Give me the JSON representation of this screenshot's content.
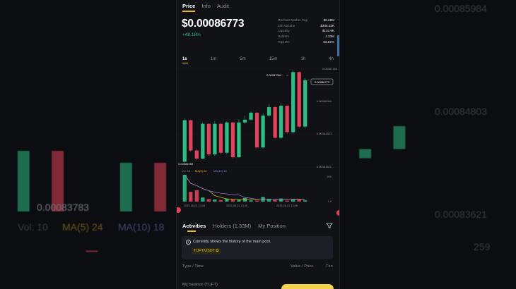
{
  "background": {
    "price_labels": [
      "0.00085984",
      "0.00084803",
      "0.00083621"
    ],
    "low_label": "0.00083783",
    "volume_label": "Vol: 10",
    "ma5_label": "MA(5) 24",
    "ma10_label": "MA(10) 18",
    "volume_max": "259"
  },
  "tabs": [
    {
      "label": "Price",
      "active": true
    },
    {
      "label": "Info",
      "active": false
    },
    {
      "label": "Audit",
      "active": false
    }
  ],
  "price": {
    "value": "$0.00086773",
    "change": "+48.18%"
  },
  "stats": [
    {
      "label": "Onchain Market Cap",
      "value": "$8.68M"
    },
    {
      "label": "24h Volume",
      "value": "$306.02K"
    },
    {
      "label": "Liquidity",
      "value": "$132.9K"
    },
    {
      "label": "Holders",
      "value": "1.33M"
    },
    {
      "label": "Top10%",
      "value": "53.92%"
    }
  ],
  "intervals": [
    {
      "label": "1s",
      "active": true
    },
    {
      "label": "1m",
      "active": false
    },
    {
      "label": "5m",
      "active": false
    },
    {
      "label": "15m",
      "active": false
    },
    {
      "label": "1h",
      "active": false
    },
    {
      "label": "4h",
      "active": false
    }
  ],
  "chart": {
    "high_label": "0.00087064",
    "low_label": "0.00083783",
    "current_label": "0.00086773",
    "price_ticks": [
      "0.00087166",
      "0.00085984",
      "0.00084803",
      "0.00083621"
    ],
    "volume_legend": {
      "vol": "Vol: 10",
      "ma5": "MA(5) 24",
      "ma10": "MA(10) 18"
    },
    "volume_ticks": [
      "259",
      "1.6"
    ],
    "time_labels": [
      "2025-06-01 13:44",
      "2025-06-01 13:45",
      "2025-06-01 13:46"
    ],
    "colors": {
      "up": "#2ebd85",
      "down": "#e0425a",
      "ma5": "#f0b90b",
      "ma10": "#8f7ae6"
    }
  },
  "chart_data": {
    "type": "candlestick",
    "candles": [
      {
        "o": 0.0008384,
        "c": 0.0008533,
        "h": 0.000854,
        "l": 0.0008378,
        "dir": "up"
      },
      {
        "o": 0.0008533,
        "c": 0.0008424,
        "h": 0.0008535,
        "l": 0.000842,
        "dir": "down"
      },
      {
        "o": 0.0008424,
        "c": 0.0008395,
        "h": 0.000843,
        "l": 0.000839,
        "dir": "down"
      },
      {
        "o": 0.0008395,
        "c": 0.000852,
        "h": 0.0008525,
        "l": 0.0008392,
        "dir": "up"
      },
      {
        "o": 0.000852,
        "c": 0.000841,
        "h": 0.0008522,
        "l": 0.0008405,
        "dir": "down"
      },
      {
        "o": 0.000841,
        "c": 0.000852,
        "h": 0.000853,
        "l": 0.0008405,
        "dir": "up"
      },
      {
        "o": 0.000852,
        "c": 0.0008416,
        "h": 0.0008525,
        "l": 0.000841,
        "dir": "down"
      },
      {
        "o": 0.0008416,
        "c": 0.0008525,
        "h": 0.000853,
        "l": 0.000841,
        "dir": "up"
      },
      {
        "o": 0.0008525,
        "c": 0.00084,
        "h": 0.0008528,
        "l": 0.0008395,
        "dir": "down"
      },
      {
        "o": 0.00084,
        "c": 0.0008525,
        "h": 0.0008535,
        "l": 0.0008398,
        "dir": "up"
      },
      {
        "o": 0.0008525,
        "c": 0.0008535,
        "h": 0.000855,
        "l": 0.000852,
        "dir": "up"
      },
      {
        "o": 0.0008535,
        "c": 0.000856,
        "h": 0.0008565,
        "l": 0.000853,
        "dir": "up"
      },
      {
        "o": 0.000856,
        "c": 0.0008435,
        "h": 0.0008562,
        "l": 0.000843,
        "dir": "down"
      },
      {
        "o": 0.0008435,
        "c": 0.000855,
        "h": 0.000856,
        "l": 0.000843,
        "dir": "up"
      },
      {
        "o": 0.000855,
        "c": 0.000858,
        "h": 0.000859,
        "l": 0.0008545,
        "dir": "up"
      },
      {
        "o": 0.000858,
        "c": 0.000847,
        "h": 0.0008582,
        "l": 0.0008465,
        "dir": "down"
      },
      {
        "o": 0.000847,
        "c": 0.0008585,
        "h": 0.0008595,
        "l": 0.0008465,
        "dir": "up"
      },
      {
        "o": 0.0008585,
        "c": 0.000849,
        "h": 0.0008588,
        "l": 0.0008485,
        "dir": "down"
      },
      {
        "o": 0.000849,
        "c": 0.0008706,
        "h": 0.0008712,
        "l": 0.0008485,
        "dir": "up"
      },
      {
        "o": 0.0008706,
        "c": 0.000851,
        "h": 0.0008708,
        "l": 0.0008505,
        "dir": "down"
      },
      {
        "o": 0.000851,
        "c": 0.0008677,
        "h": 0.0008685,
        "l": 0.0008505,
        "dir": "up"
      }
    ],
    "volume": [
      260,
      95,
      110,
      40,
      25,
      20,
      15,
      30,
      22,
      18,
      35,
      12,
      10,
      45,
      20,
      15,
      30,
      10,
      25,
      18,
      12
    ],
    "ylim": [
      0.0008362,
      0.0008717
    ]
  }
}
